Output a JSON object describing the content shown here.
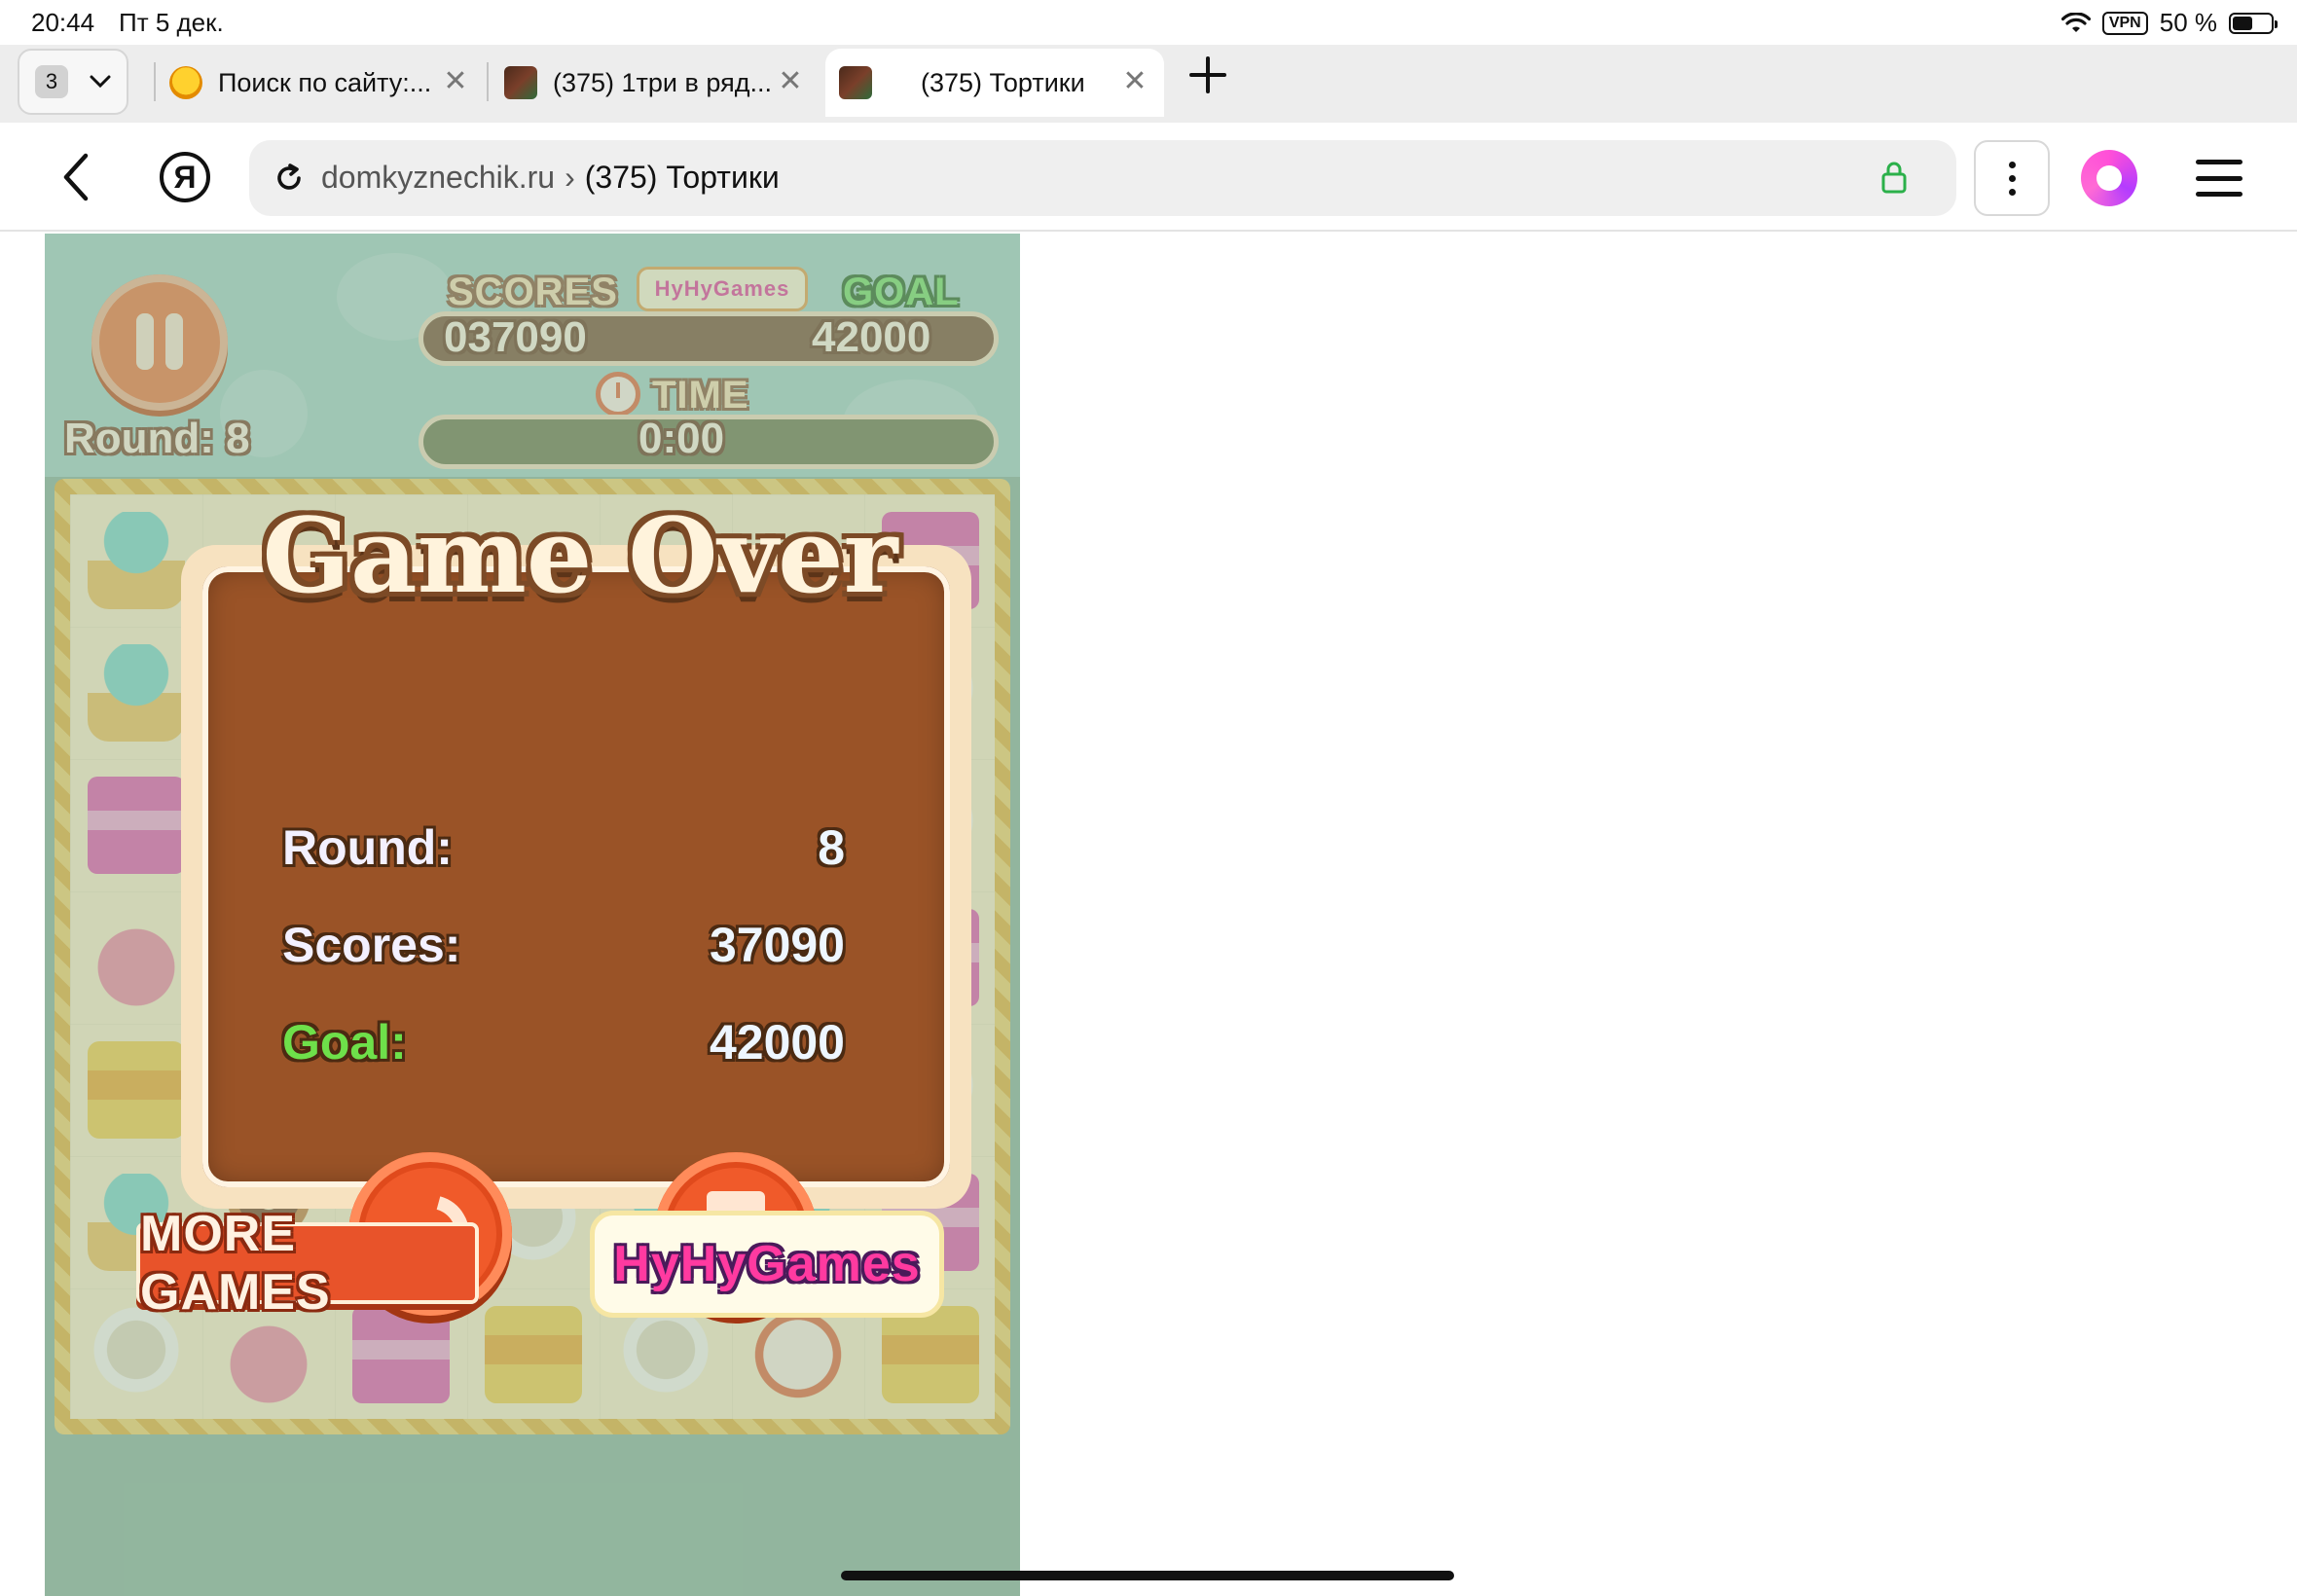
{
  "status_bar": {
    "time": "20:44",
    "date": "Пт 5 дек.",
    "vpn": "VPN",
    "battery": "50 %",
    "battery_level": 0.5
  },
  "tabs": {
    "count": "3",
    "items": [
      {
        "title": "Поиск по сайту:...",
        "icon": "duck-favicon",
        "active": false
      },
      {
        "title": "(375) 1три в ряд...",
        "icon": "cake-favicon",
        "active": false
      },
      {
        "title": "(375) Тортики",
        "icon": "cake-favicon",
        "active": true
      }
    ]
  },
  "nav": {
    "yandex_logo": "Я",
    "domain": "domkyznechik.ru",
    "separator": "›",
    "page_title": "(375) Тортики"
  },
  "game": {
    "round_label": "Round: 8",
    "scores_title": "SCORES",
    "score_value": "037090",
    "goal_title": "GOAL",
    "goal_value": "42000",
    "time_title": "TIME",
    "time_value": "0:00",
    "logo_text": "HyHyGames",
    "dialog": {
      "title": "Game Over",
      "round_label": "Round:",
      "round_value": "8",
      "scores_label": "Scores:",
      "scores_value": "37090",
      "goal_label": "Goal:",
      "goal_value": "42000"
    },
    "more_games": "MORE GAMES",
    "logo_large": "HyHyGames"
  },
  "colors": {
    "accent_orange": "#f05a2a",
    "dialog_brown": "#9a5327",
    "goal_green": "#6ee04a",
    "game_bg": "#8fb79d"
  }
}
